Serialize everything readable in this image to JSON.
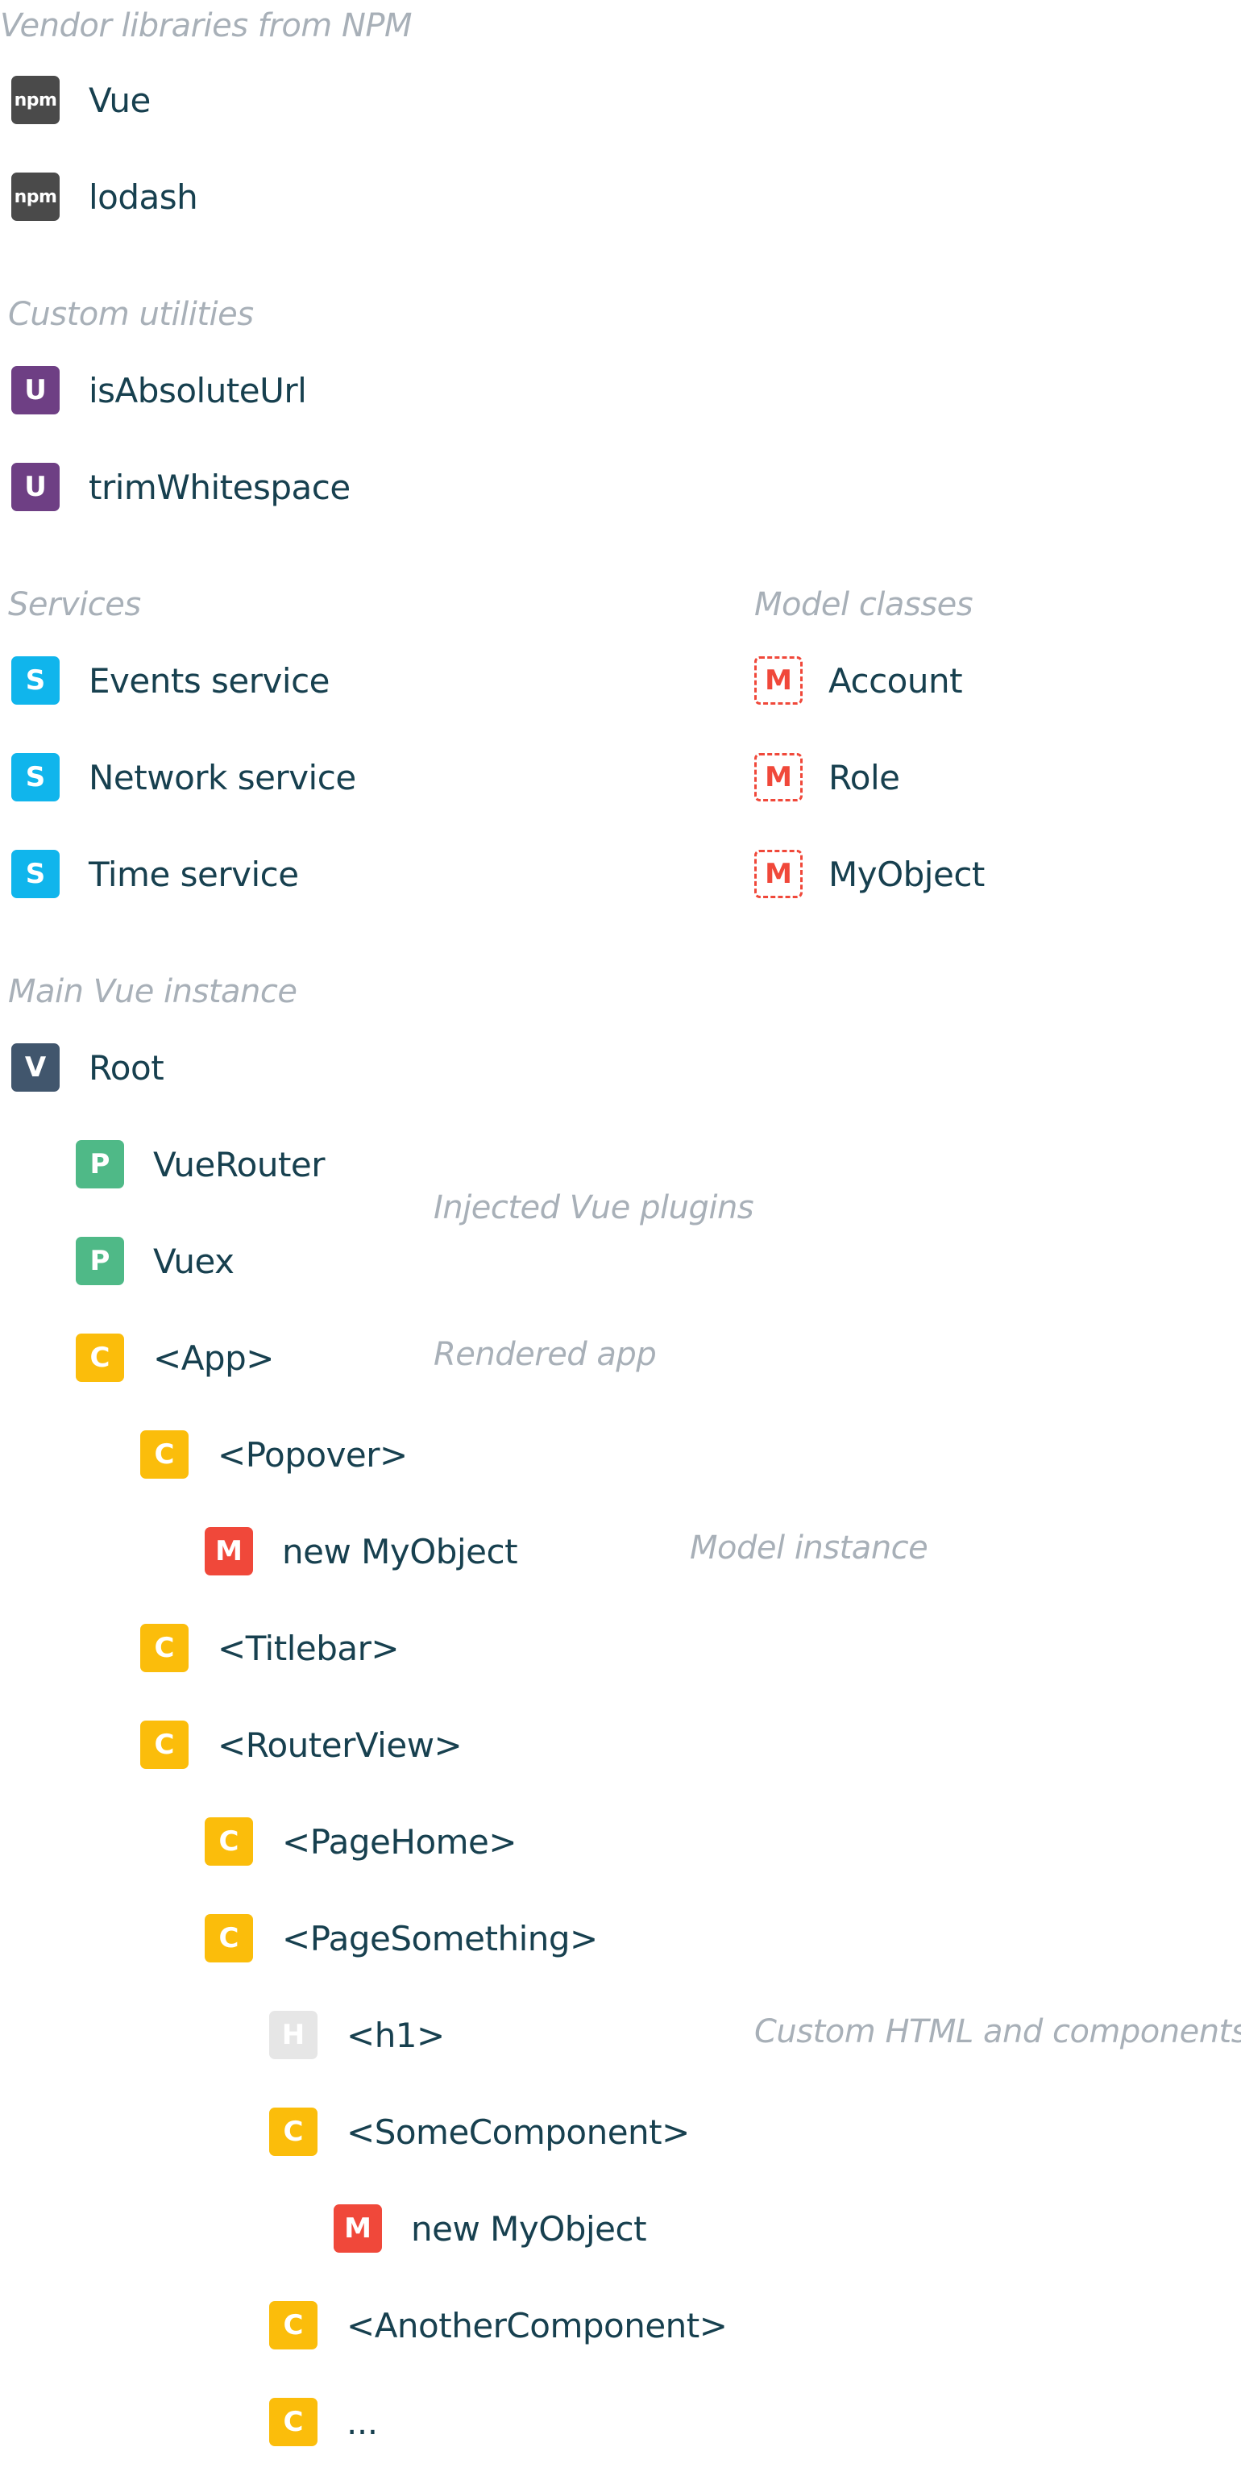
{
  "colors": {
    "npm": "#4a4a4a",
    "utility": "#6e3f84",
    "service": "#10b5ec",
    "model_class": "#f0483a",
    "vue": "#41566d",
    "plugin": "#4fb987",
    "component": "#fbbd0b",
    "model_instance": "#f0483a",
    "html": "#e6e6e6",
    "section_title": "#a8b0b8",
    "label": "#17404f"
  },
  "sections": {
    "vendor": "Vendor libraries from NPM",
    "utilities": "Custom utilities",
    "services": "Services",
    "models": "Model classes",
    "main": "Main Vue instance"
  },
  "annotations": {
    "plugins": "Injected Vue plugins",
    "app": "Rendered app",
    "model_instance": "Model instance",
    "custom_html": "Custom HTML and components"
  },
  "vendor": [
    {
      "badge": "npm",
      "label": "Vue"
    },
    {
      "badge": "npm",
      "label": "lodash"
    }
  ],
  "utilities": [
    {
      "badge": "U",
      "label": "isAbsoluteUrl"
    },
    {
      "badge": "U",
      "label": "trimWhitespace"
    }
  ],
  "services": [
    {
      "badge": "S",
      "label": "Events service"
    },
    {
      "badge": "S",
      "label": "Network service"
    },
    {
      "badge": "S",
      "label": "Time service"
    }
  ],
  "models": [
    {
      "badge": "M",
      "label": "Account"
    },
    {
      "badge": "M",
      "label": "Role"
    },
    {
      "badge": "M",
      "label": "MyObject"
    }
  ],
  "tree": [
    {
      "badge": "V",
      "kind": "vue",
      "label": "Root"
    },
    {
      "badge": "P",
      "kind": "plugin",
      "label": "VueRouter"
    },
    {
      "badge": "P",
      "kind": "plugin",
      "label": "Vuex"
    },
    {
      "badge": "C",
      "kind": "component",
      "label": "<App>"
    },
    {
      "badge": "C",
      "kind": "component",
      "label": "<Popover>"
    },
    {
      "badge": "M",
      "kind": "model_instance",
      "label": "new MyObject"
    },
    {
      "badge": "C",
      "kind": "component",
      "label": "<Titlebar>"
    },
    {
      "badge": "C",
      "kind": "component",
      "label": "<RouterView>"
    },
    {
      "badge": "C",
      "kind": "component",
      "label": "<PageHome>"
    },
    {
      "badge": "C",
      "kind": "component",
      "label": "<PageSomething>"
    },
    {
      "badge": "H",
      "kind": "html",
      "label": "<h1>"
    },
    {
      "badge": "C",
      "kind": "component",
      "label": "<SomeComponent>"
    },
    {
      "badge": "M",
      "kind": "model_instance",
      "label": "new MyObject"
    },
    {
      "badge": "C",
      "kind": "component",
      "label": "<AnotherComponent>"
    },
    {
      "badge": "C",
      "kind": "component",
      "label": "..."
    }
  ]
}
